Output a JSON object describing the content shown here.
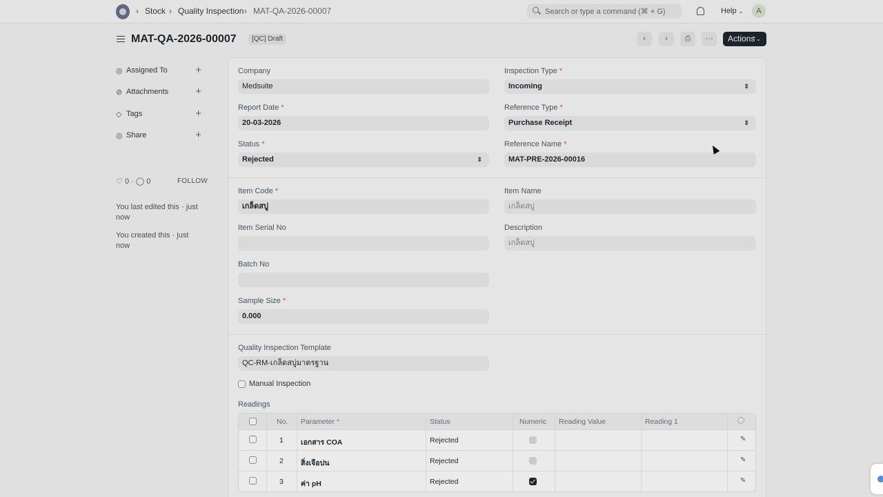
{
  "navbar": {
    "breadcrumbs": [
      "Stock",
      "Quality Inspection",
      "MAT-QA-2026-00007"
    ],
    "search_placeholder": "Search or type a command (⌘ + G)",
    "help_label": "Help",
    "avatar_initial": "A"
  },
  "page": {
    "title": "MAT-QA-2026-00007",
    "status_badge": "[QC] Draft",
    "actions_label": "Actions"
  },
  "sidebar": {
    "items": [
      {
        "label": "Assigned To",
        "icon": "user-icon"
      },
      {
        "label": "Attachments",
        "icon": "paperclip-icon"
      },
      {
        "label": "Tags",
        "icon": "tag-icon"
      },
      {
        "label": "Share",
        "icon": "share-icon"
      }
    ],
    "like_count": "0",
    "comment_count": "0",
    "follow_label": "FOLLOW",
    "activity": [
      "You last edited this · just now",
      "You created this · just now"
    ]
  },
  "form": {
    "company": {
      "label": "Company",
      "value": "Medsuite"
    },
    "inspection_type": {
      "label": "Inspection Type",
      "value": "Incoming"
    },
    "report_date": {
      "label": "Report Date",
      "value": "20-03-2026"
    },
    "reference_type": {
      "label": "Reference Type",
      "value": "Purchase Receipt"
    },
    "status": {
      "label": "Status",
      "value": "Rejected"
    },
    "reference_name": {
      "label": "Reference Name",
      "value": "MAT-PRE-2026-00016"
    },
    "item_code": {
      "label": "Item Code",
      "value": "เกล็ดสบู่"
    },
    "item_name": {
      "label": "Item Name",
      "value": "เกล็ดสบู่"
    },
    "item_serial_no": {
      "label": "Item Serial No",
      "value": ""
    },
    "description": {
      "label": "Description",
      "value": "เกล็ดสบู่"
    },
    "batch_no": {
      "label": "Batch No",
      "value": ""
    },
    "sample_size": {
      "label": "Sample Size",
      "value": "0.000"
    },
    "qi_template": {
      "label": "Quality Inspection Template",
      "value": "QC-RM-เกล็ดสบู่มาตรฐาน"
    },
    "manual_inspection_label": "Manual Inspection",
    "required_mark": "*"
  },
  "readings": {
    "label": "Readings",
    "columns": [
      "No.",
      "Parameter",
      "Status",
      "Numeric",
      "Reading Value",
      "Reading 1"
    ],
    "rows": [
      {
        "no": "1",
        "parameter": "เอกสาร COA",
        "status": "Rejected",
        "numeric": false
      },
      {
        "no": "2",
        "parameter": "สิ่งเจือปน",
        "status": "Rejected",
        "numeric": false
      },
      {
        "no": "3",
        "parameter": "ค่า pH",
        "status": "Rejected",
        "numeric": true
      }
    ]
  }
}
